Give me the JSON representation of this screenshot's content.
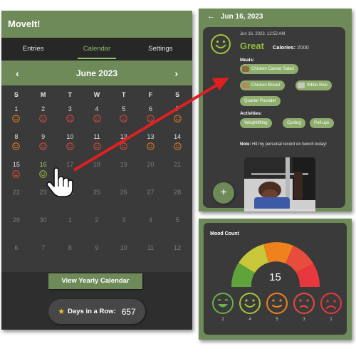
{
  "app": {
    "title": "MoveIt!"
  },
  "tabs": [
    {
      "label": "Entries"
    },
    {
      "label": "Calendar",
      "active": true
    },
    {
      "label": "Settings"
    }
  ],
  "calendar": {
    "month_title": "June  2023",
    "weekdays": [
      "S",
      "M",
      "T",
      "W",
      "T",
      "F",
      "S"
    ],
    "weeks": [
      [
        {
          "n": "1",
          "mood": "neutral-orange"
        },
        {
          "n": "2",
          "mood": "sad-red"
        },
        {
          "n": "3",
          "mood": "sad-red"
        },
        {
          "n": "4",
          "mood": "sad-red"
        },
        {
          "n": "5",
          "mood": "sad-red"
        },
        {
          "n": "6",
          "mood": "sad-red"
        },
        {
          "n": "7",
          "mood": "neutral-orange"
        }
      ],
      [
        {
          "n": "8",
          "mood": "neutral-orange"
        },
        {
          "n": "9",
          "mood": "sad-red"
        },
        {
          "n": "10",
          "mood": "sad-red"
        },
        {
          "n": "11",
          "mood": "sad-red"
        },
        {
          "n": "12",
          "mood": "sad-red"
        },
        {
          "n": "13",
          "mood": "neutral-orange"
        },
        {
          "n": "14",
          "mood": "neutral-orange"
        }
      ],
      [
        {
          "n": "15",
          "mood": "sad-red"
        },
        {
          "n": "16",
          "mood": "happy-green",
          "selected": true
        },
        {
          "n": "17",
          "dim": true
        },
        {
          "n": "18",
          "dim": true
        },
        {
          "n": "19",
          "dim": true
        },
        {
          "n": "20",
          "dim": true
        },
        {
          "n": "21",
          "dim": true
        }
      ],
      [
        {
          "n": "22",
          "dim": true
        },
        {
          "n": "23",
          "dim": true
        },
        {
          "n": "24",
          "dim": true
        },
        {
          "n": "25",
          "dim": true
        },
        {
          "n": "26",
          "dim": true
        },
        {
          "n": "27",
          "dim": true
        },
        {
          "n": "28",
          "dim": true
        }
      ],
      [
        {
          "n": "29",
          "dim": true
        },
        {
          "n": "30",
          "dim": true
        },
        {
          "n": "1",
          "dim": true
        },
        {
          "n": "2",
          "dim": true
        },
        {
          "n": "3",
          "dim": true
        },
        {
          "n": "4",
          "dim": true
        },
        {
          "n": "5",
          "dim": true
        }
      ],
      [
        {
          "n": "6",
          "dim": true
        },
        {
          "n": "7",
          "dim": true
        },
        {
          "n": "8",
          "dim": true
        },
        {
          "n": "9",
          "dim": true
        },
        {
          "n": "10",
          "dim": true
        },
        {
          "n": "11",
          "dim": true
        },
        {
          "n": "12",
          "dim": true
        }
      ]
    ],
    "prev_icon": "chevron-left-icon",
    "next_icon": "chevron-right-icon"
  },
  "footer": {
    "yearly_button": "View Yearly Calendar",
    "streak_label": "Days in a Row:",
    "streak_value": "657",
    "streak_icon": "star-icon"
  },
  "entry": {
    "header_date": "Jun 16, 2023",
    "back_icon": "arrow-left-icon",
    "timestamp": "Jun 16, 2023, 12:52 AM",
    "mood": "Great",
    "calories_label": "Calories:",
    "calories_value": "2000",
    "meals_label": "Meals:",
    "meals": [
      "Chicken Caesar Salad",
      "Chicken Breast",
      "White Rice",
      "Quarter Pounder"
    ],
    "activities_label": "Activities:",
    "activities": [
      "Weightlifting",
      "Cycling",
      "Pull-ups"
    ],
    "note_label": "Note:",
    "note_text": "Hit my personal record on bench today!",
    "add_label": "+"
  },
  "mood_count": {
    "title": "Mood Count",
    "total": "15",
    "moods": [
      {
        "name": "very-happy",
        "color": "#6ab04c",
        "count": "2"
      },
      {
        "name": "happy",
        "color": "#a4c63a",
        "count": "4"
      },
      {
        "name": "neutral",
        "color": "#f0821e",
        "count": "5"
      },
      {
        "name": "sad",
        "color": "#e74c3c",
        "count": "3"
      },
      {
        "name": "very-sad",
        "color": "#e8383d",
        "count": "1"
      }
    ]
  },
  "colors": {
    "accent_green": "#6d8a58",
    "dark_bg": "#3a3a3a",
    "mood_great": "#8fbf3a",
    "arrow_red": "#e02020"
  }
}
